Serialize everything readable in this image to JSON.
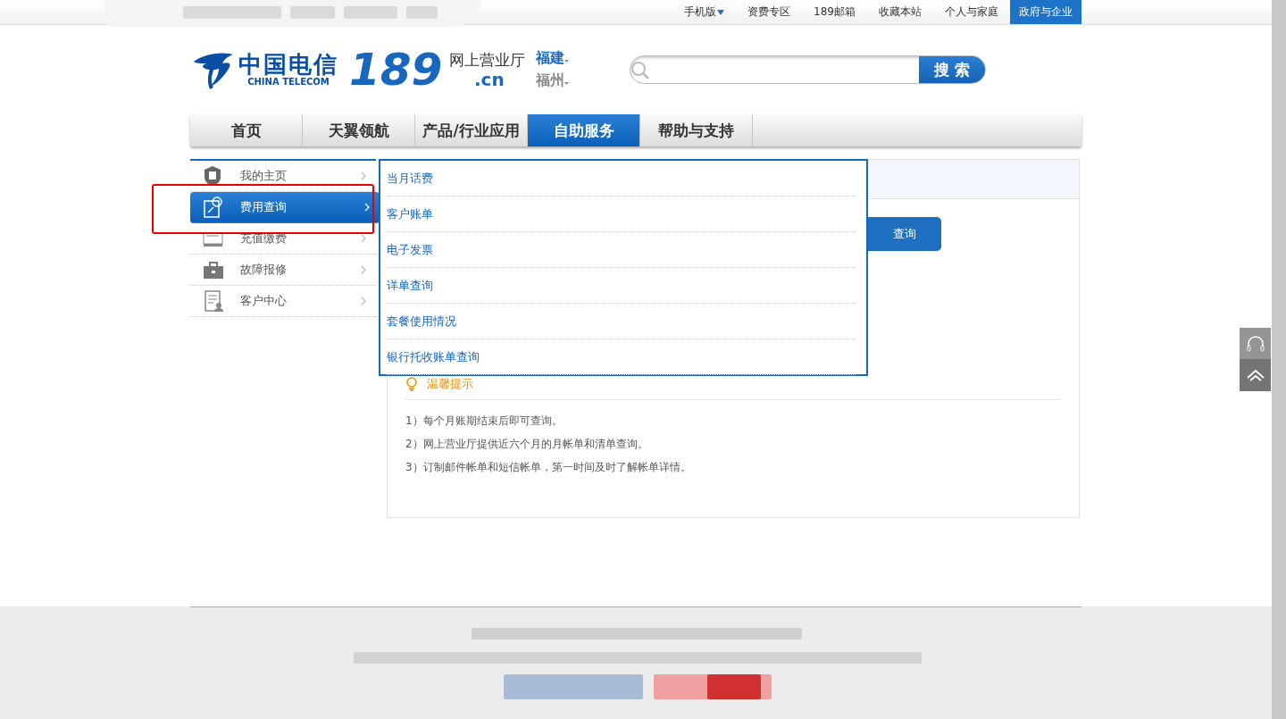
{
  "top_links": [
    {
      "label": "手机版",
      "kind": "dropdown",
      "selected": false
    },
    {
      "label": "资费专区",
      "kind": "link",
      "selected": false
    },
    {
      "label": "189邮箱",
      "kind": "link",
      "selected": false
    },
    {
      "label": "收藏本站",
      "kind": "link",
      "selected": false
    },
    {
      "label": "个人与家庭",
      "kind": "link",
      "selected": false
    },
    {
      "label": "政府与企业",
      "kind": "link",
      "selected": true
    }
  ],
  "header": {
    "logo_cn": "中国电信",
    "logo_en": "CHINA TELECOM",
    "logo_number": "189",
    "logo_domain": ".cn",
    "site_name": "网上营业厅",
    "province": "福建",
    "city": "福州",
    "search_button": "搜 索"
  },
  "nav": [
    {
      "label": "首页",
      "selected": false
    },
    {
      "label": "天翼领航",
      "selected": false
    },
    {
      "label": "产品/行业应用",
      "selected": false
    },
    {
      "label": "自助服务",
      "selected": true
    },
    {
      "label": "帮助与支持",
      "selected": false
    }
  ],
  "sidebar": [
    {
      "label": "我的主页",
      "selected": false
    },
    {
      "label": "费用查询",
      "selected": true
    },
    {
      "label": "充值缴费",
      "selected": false
    },
    {
      "label": "故障报修",
      "selected": false
    },
    {
      "label": "客户中心",
      "selected": false
    }
  ],
  "dropdown": [
    "当月话费",
    "客户账单",
    "电子发票",
    "详单查询",
    "套餐使用情况",
    "银行托收账单查询"
  ],
  "panel": {
    "query_button": "查询",
    "tip_title": "温馨提示",
    "tips": [
      "1）每个月账期结束后即可查询。",
      "2）网上营业厅提供近六个月的月帐单和清单查询。",
      "3）订制邮件帐单和短信帐单，第一时间及时了解帐单详情。"
    ]
  }
}
